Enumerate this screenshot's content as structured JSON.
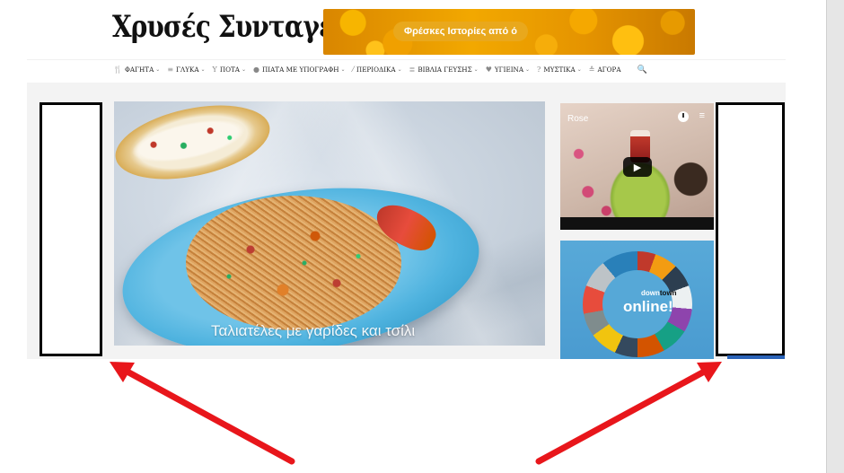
{
  "header": {
    "logo_text": "Χρυσές Συνταγές",
    "banner_text": "Φρέσκες Ιστορίες από ό"
  },
  "nav": {
    "items": [
      {
        "label": "ΦΑΓΗΤΑ",
        "icon": "fork-knife-icon",
        "glyph": "🍴",
        "dropdown": true
      },
      {
        "label": "ΓΛΥΚΑ",
        "icon": "cake-icon",
        "glyph": "≡",
        "dropdown": true
      },
      {
        "label": "ΠΟΤΑ",
        "icon": "cocktail-icon",
        "glyph": "Y",
        "dropdown": true
      },
      {
        "label": "ΠΙΑΤΑ ΜΕ ΥΠΟΓΡΑΦΗ",
        "icon": "dish-icon",
        "glyph": "●",
        "dropdown": true
      },
      {
        "label": "ΠΕΡΙΟΔΙΚΑ",
        "icon": "pen-icon",
        "glyph": "⁄",
        "dropdown": true
      },
      {
        "label": "ΒΙΒΛΙΑ ΓΕΥΣΗΣ",
        "icon": "book-icon",
        "glyph": "≣",
        "dropdown": true
      },
      {
        "label": "ΥΓΙΕΙΝΑ",
        "icon": "heart-icon",
        "glyph": "♥",
        "dropdown": true
      },
      {
        "label": "ΜΥΣΤΙΚΑ",
        "icon": "question-icon",
        "glyph": "?",
        "dropdown": true
      },
      {
        "label": "ΑΓΟΡΑ",
        "icon": "cart-icon",
        "glyph": "≙",
        "dropdown": false
      }
    ],
    "search_glyph": "🔍"
  },
  "hero": {
    "caption": "Ταλιατέλες με γαρίδες και τσίλι"
  },
  "video": {
    "title": "Rose",
    "play_glyph": "▶",
    "playlist_glyph": "≡"
  },
  "downtown_ad": {
    "small_prefix": "down",
    "small_strong": "town",
    "big": "online!"
  },
  "colors": {
    "arrow": "#e8161b",
    "ad_border": "#000000",
    "accent_blue": "#2a63b8"
  }
}
